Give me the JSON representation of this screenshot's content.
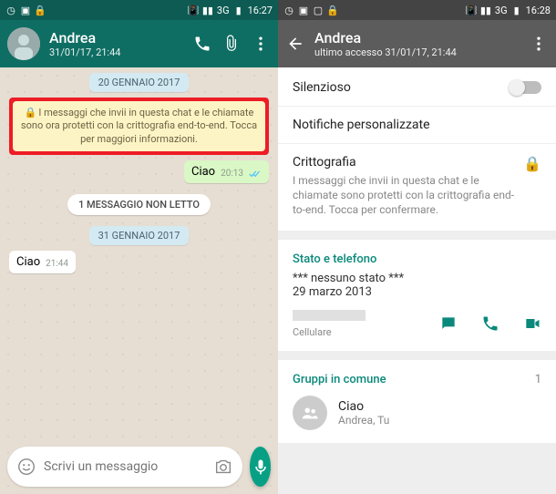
{
  "left": {
    "statusbar": {
      "time": "16:27",
      "network": "3G"
    },
    "header": {
      "name": "Andrea",
      "subtitle": "31/01/17, 21:44"
    },
    "dateChip1": "20 GENNAIO 2017",
    "encryption": "I messaggi che invii in questa chat e le chiamate sono ora protetti con la crittografia end-to-end. Tocca per maggiori informazioni.",
    "msgOut": {
      "text": "Ciao",
      "time": "20:13"
    },
    "unread": "1 MESSAGGIO NON LETTO",
    "dateChip2": "31 GENNAIO 2017",
    "msgIn": {
      "text": "Ciao",
      "time": "21:44"
    },
    "composerPlaceholder": "Scrivi un messaggio"
  },
  "right": {
    "statusbar": {
      "time": "16:28",
      "network": "3G"
    },
    "header": {
      "name": "Andrea",
      "subtitle": "ultimo accesso 31/01/17, 21:44"
    },
    "mute": "Silenzioso",
    "custom": "Notifiche personalizzate",
    "crypto": {
      "title": "Crittografia",
      "body": "I messaggi che invii in questa chat e le chiamate sono protetti con la crittografia end-to-end. Tocca per confermare."
    },
    "statusSection": "Stato e telefono",
    "statusText": "*** nessuno stato ***",
    "statusDate": "29 marzo 2013",
    "phoneLabel": "Cellulare",
    "groupsSection": "Gruppi in comune",
    "groupsCount": "1",
    "group": {
      "name": "Ciao",
      "members": "Andrea, Tu"
    }
  }
}
